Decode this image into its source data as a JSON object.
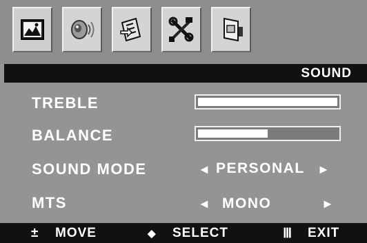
{
  "menu": {
    "title": "SOUND",
    "tabs": [
      {
        "icon": "picture-icon"
      },
      {
        "icon": "sound-icon"
      },
      {
        "icon": "setup-icon"
      },
      {
        "icon": "tools-icon"
      },
      {
        "icon": "input-source-icon"
      }
    ],
    "items": [
      {
        "label": "TREBLE",
        "type": "slider",
        "level_percent": 100
      },
      {
        "label": "BALANCE",
        "type": "slider",
        "level_percent": 50
      },
      {
        "label": "SOUND MODE",
        "type": "select",
        "value": "PERSONAL"
      },
      {
        "label": "MTS",
        "type": "select",
        "value": "MONO"
      }
    ]
  },
  "footer": {
    "move_symbol": "±",
    "move_label": "MOVE",
    "select_symbol": "◆",
    "select_label": "SELECT",
    "exit_symbol": "Ⅲ",
    "exit_label": "EXIT"
  },
  "colors": {
    "panel": "#949494",
    "bars": "#111111",
    "text": "#ffffff",
    "tab": "#d4d4d4"
  }
}
